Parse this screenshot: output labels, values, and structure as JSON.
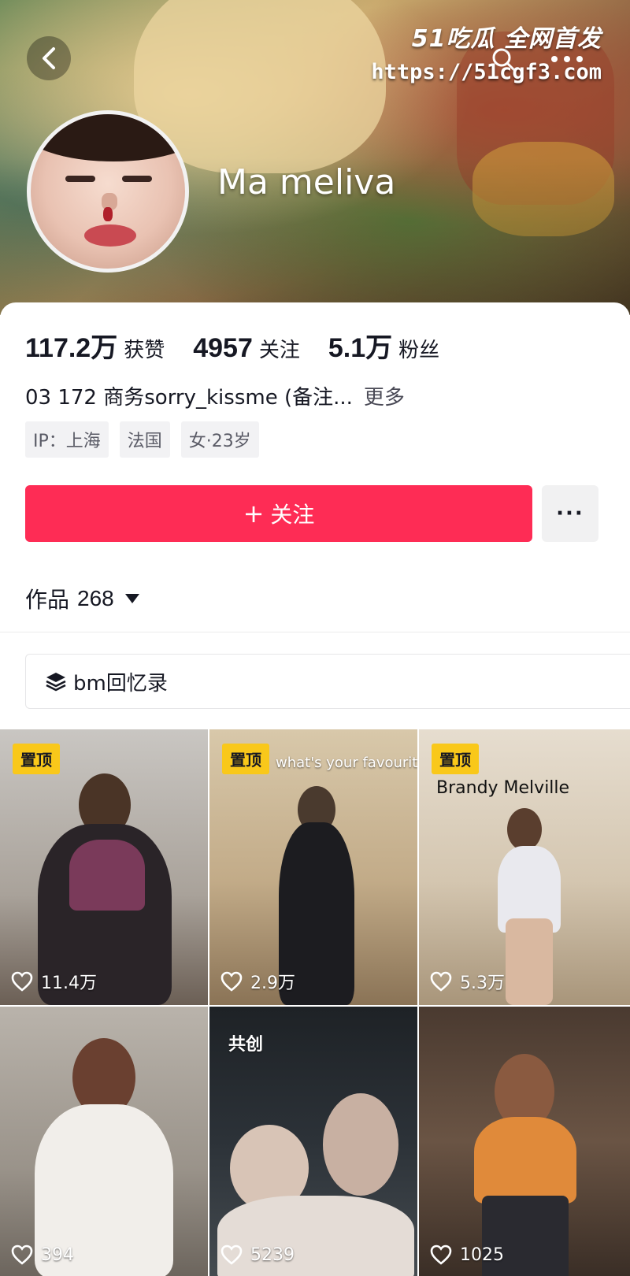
{
  "watermark": {
    "brand": "51吃瓜 全网首发",
    "url": "https://51cgf3.com"
  },
  "profile": {
    "nickname": "Ma meliva"
  },
  "stats": [
    {
      "value": "117.2万",
      "label": "获赞"
    },
    {
      "value": "4957",
      "label": "关注"
    },
    {
      "value": "5.1万",
      "label": "粉丝"
    }
  ],
  "bio": {
    "text": "03 172  商务sorry_kissme (备注...",
    "more_label": "更多"
  },
  "tags": [
    "IP：上海",
    "法国",
    "女·23岁"
  ],
  "actions": {
    "follow_plus": "+",
    "follow_label": "关注",
    "more_label": "···"
  },
  "works": {
    "label": "作品",
    "count": "268"
  },
  "collection": {
    "label": "bm回忆录"
  },
  "videos": [
    {
      "badge": "置顶",
      "likes": "11.4万",
      "overlay": ""
    },
    {
      "badge": "置顶",
      "likes": "2.9万",
      "overlay": "what's your favourite?"
    },
    {
      "badge": "置顶",
      "likes": "5.3万",
      "overlay": "Brandy Melville"
    },
    {
      "badge": "",
      "likes": "394",
      "overlay": ""
    },
    {
      "badge": "共创",
      "likes": "5239",
      "overlay": ""
    },
    {
      "badge": "",
      "likes": "1025",
      "overlay": ""
    }
  ],
  "colors": {
    "accent": "#fe2c55",
    "pin": "#f9c81a"
  }
}
